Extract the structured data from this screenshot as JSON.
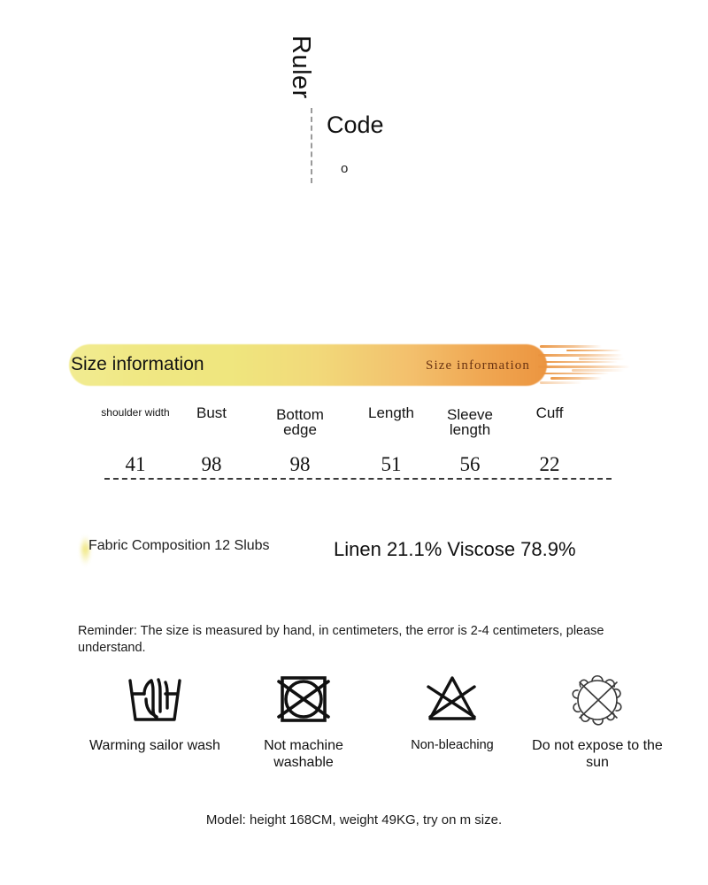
{
  "header": {
    "ruler_word": "Ruler",
    "code_word": "Code",
    "degree_mark": "o"
  },
  "fabric": {
    "label": "Fabric Composition 12 Slubs",
    "value": "Linen 21.1% Viscose 78.9%"
  },
  "size_banner": {
    "title": "Size information",
    "subtitle": "Size  information",
    "gradient_start": "#f2ec92",
    "gradient_end": "#ec9540",
    "subtitle_color": "#6b3412"
  },
  "size_table": {
    "headers": [
      "shoulder width",
      "Bust",
      "Bottom edge",
      "Length",
      "Sleeve length",
      "Cuff"
    ],
    "values": [
      "41",
      "98",
      "98",
      "51",
      "56",
      "22"
    ]
  },
  "reminder": "Reminder: The size is measured by hand, in centimeters, the error is 2-4 centimeters, please understand.",
  "care": [
    {
      "icon": "hand-wash-icon",
      "label": "Warming sailor wash"
    },
    {
      "icon": "no-machine-wash-icon",
      "label": "Not machine washable"
    },
    {
      "icon": "no-bleach-icon",
      "label": "Non-bleaching"
    },
    {
      "icon": "no-sun-icon",
      "label": "Do not expose to the sun"
    }
  ],
  "model_note": "Model: height 168CM, weight 49KG, try on m size."
}
